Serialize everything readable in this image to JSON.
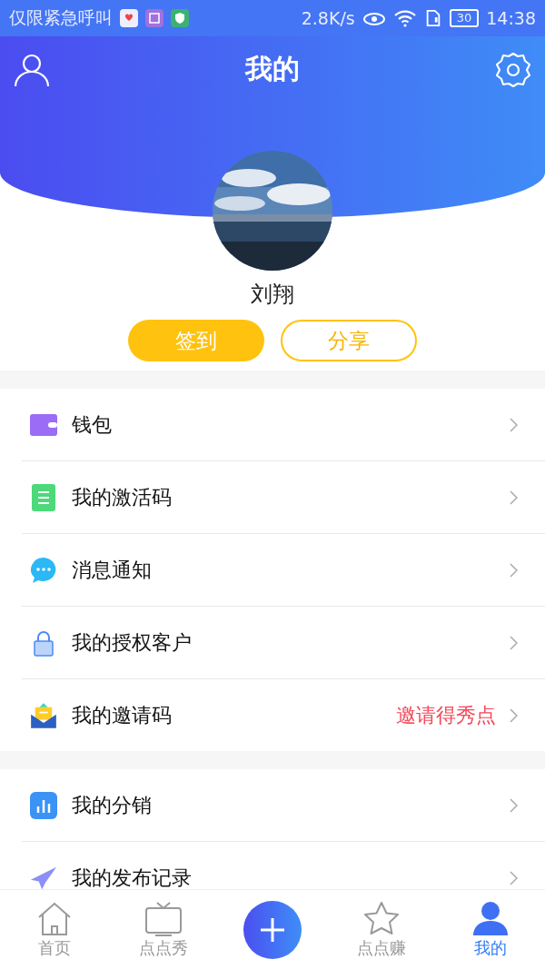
{
  "status_bar": {
    "carrier": "仅限紧急呼叫",
    "speed": "2.8K/s",
    "battery": "30",
    "time": "14:38"
  },
  "header": {
    "title": "我的"
  },
  "profile": {
    "name": "刘翔"
  },
  "actions": [
    {
      "label": "签到",
      "kind": "filled"
    },
    {
      "label": "分享",
      "kind": "outline"
    }
  ],
  "sections": [
    [
      {
        "label": "钱包",
        "kind": "wallet"
      },
      {
        "label": "我的激活码",
        "kind": "list"
      },
      {
        "label": "消息通知",
        "kind": "chat"
      },
      {
        "label": "我的授权客户",
        "kind": "lock"
      },
      {
        "label": "我的邀请码",
        "kind": "mail",
        "note": "邀请得秀点"
      }
    ],
    [
      {
        "label": "我的分销",
        "kind": "chart"
      },
      {
        "label": "我的发布记录",
        "kind": "plane"
      }
    ]
  ],
  "tabs": [
    {
      "label": "首页",
      "kind": "home",
      "selected": false
    },
    {
      "label": "点点秀",
      "kind": "tv",
      "selected": false
    },
    {
      "kind": "plus"
    },
    {
      "label": "点点赚",
      "kind": "star",
      "selected": false
    },
    {
      "label": "我的",
      "kind": "user",
      "selected": true
    }
  ]
}
